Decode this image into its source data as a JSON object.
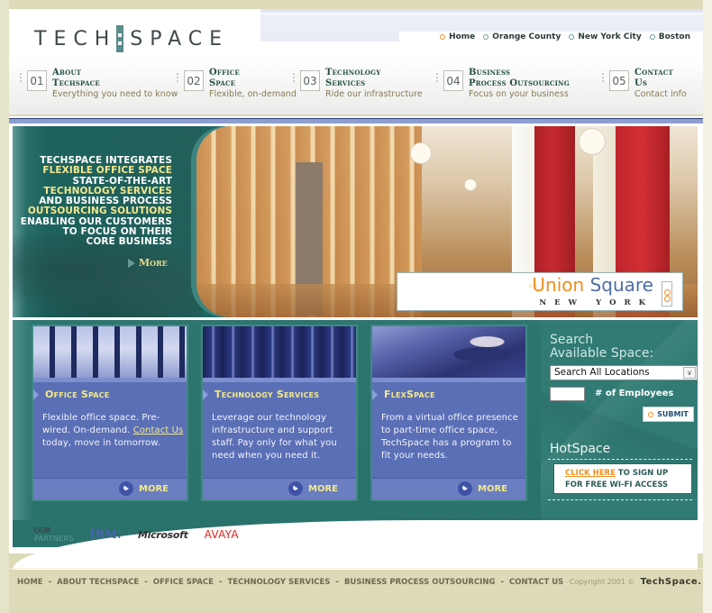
{
  "brand": {
    "logo_left": "TECH",
    "logo_right": "SPACE"
  },
  "locations": [
    {
      "label": "Home",
      "active": true
    },
    {
      "label": "Orange County",
      "active": false
    },
    {
      "label": "New York City",
      "active": false
    },
    {
      "label": "Boston",
      "active": false
    }
  ],
  "nav": [
    {
      "num": "01",
      "title1": "About",
      "title2": "Techspace",
      "sub": "Everything you need to know"
    },
    {
      "num": "02",
      "title1": "Office",
      "title2": "Space",
      "sub": "Flexible, on-demand"
    },
    {
      "num": "03",
      "title1": "Technology",
      "title2": "Services",
      "sub": "Ride our infrastructure"
    },
    {
      "num": "04",
      "title1": "Business",
      "title2": "Process Outsourcing",
      "sub": "Focus on your business"
    },
    {
      "num": "05",
      "title1": "Contact",
      "title2": "Us",
      "sub": "Contact info"
    }
  ],
  "hero": {
    "lines": [
      {
        "text": "TECHSPACE INTEGRATES",
        "highlight": false
      },
      {
        "text": "FLEXIBLE OFFICE SPACE",
        "highlight": true
      },
      {
        "text": "STATE-OF-THE-ART",
        "highlight": false
      },
      {
        "text": "TECHNOLOGY SERVICES",
        "highlight": true
      },
      {
        "text": "AND BUSINESS PROCESS",
        "highlight": false
      },
      {
        "text": "OUTSOURCING SOLUTIONS",
        "highlight": true
      },
      {
        "text": "ENABLING OUR CUSTOMERS",
        "highlight": false
      },
      {
        "text": "TO FOCUS ON THEIR",
        "highlight": false
      },
      {
        "text": "CORE BUSINESS",
        "highlight": false
      }
    ],
    "more_label": "More",
    "location_badge": {
      "name_part1": "Union",
      "name_part2": "Square",
      "city": "NEW YORK"
    }
  },
  "cards": [
    {
      "title": "Office Space",
      "body_before_link": "Flexible office space. Pre-wired. On-demand. ",
      "link": "Contact Us",
      "body_after_link": " today, move in tomorrow.",
      "more_label": "MORE"
    },
    {
      "title": "Technology Services",
      "body_before_link": "Leverage our technology infrastructure and support staff. Pay only for what you need when you need it.",
      "link": "",
      "body_after_link": "",
      "more_label": "MORE"
    },
    {
      "title": "FlexSpace",
      "body_before_link": "From a virtual office presence to part-time office space, TechSpace has a program to fit your needs.",
      "link": "",
      "body_after_link": "",
      "more_label": "MORE"
    }
  ],
  "search": {
    "title_line1": "Search",
    "title_line2": "Available Space:",
    "location_selected": "Search All Locations",
    "employees_value": "",
    "employees_label": "# of Employees",
    "submit_label": "SUBMIT"
  },
  "hotspace": {
    "title": "HotSpace",
    "click_label": "CLICK HERE",
    "text_line1_rest": " TO SIGN UP",
    "text_line2": "FOR FREE WI-FI ACCESS"
  },
  "partners": {
    "label_line1": "OUR",
    "label_line2": "PARTNERS",
    "logos": [
      "IBM.",
      "Microsoft",
      "AVAYA"
    ]
  },
  "footer": {
    "links": [
      "HOME",
      "ABOUT TECHSPACE",
      "OFFICE SPACE",
      "TECHNOLOGY SERVICES",
      "BUSINESS PROCESS OUTSOURCING",
      "CONTACT US"
    ],
    "separator": "-",
    "copyright": "Copyright 2001 ©",
    "brand": "TechSpace."
  },
  "colors": {
    "accent_teal": "#2e756f",
    "card_blue": "#5a6fb6",
    "highlight_yellow": "#f2e98c",
    "orange": "#f08c1c",
    "page_bg": "#dcdab8"
  }
}
